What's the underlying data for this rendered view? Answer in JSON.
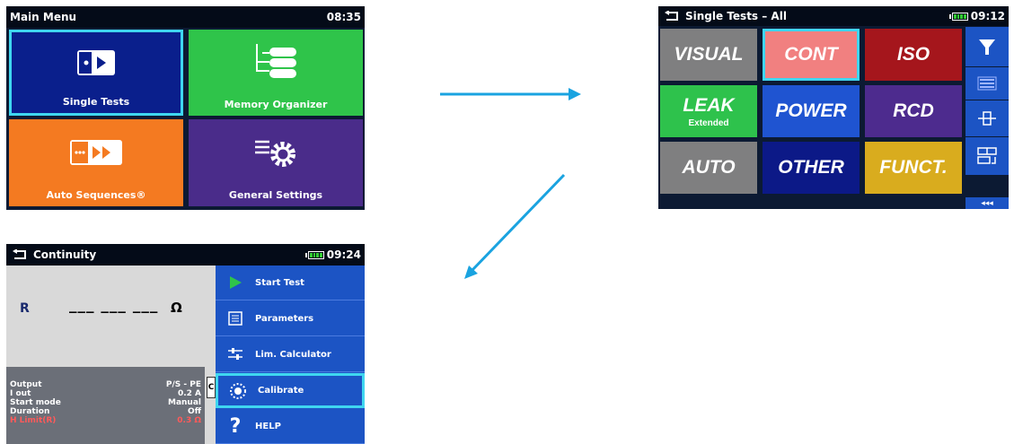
{
  "main_menu": {
    "title": "Main Menu",
    "time": "08:35",
    "tiles": [
      {
        "label": "Single Tests",
        "color": "#0a1f8c",
        "selected": true,
        "icon": "single-test-icon"
      },
      {
        "label": "Memory Organizer",
        "color": "#2fc44a",
        "icon": "memory-tree-icon"
      },
      {
        "label": "Auto Sequences®",
        "color": "#f47a21",
        "icon": "auto-sequence-icon"
      },
      {
        "label": "General Settings",
        "color": "#4a2c8a",
        "icon": "settings-gear-icon"
      }
    ]
  },
  "single_tests": {
    "title": "Single Tests – All",
    "time": "09:12",
    "tiles": [
      {
        "label": "VISUAL",
        "color": "#7f7f80"
      },
      {
        "label": "CONT",
        "color": "#f18080",
        "selected": true
      },
      {
        "label": "ISO",
        "color": "#a5161c"
      },
      {
        "label": "LEAK",
        "sub": "Extended",
        "color": "#2ec24c"
      },
      {
        "label": "POWER",
        "color": "#1f54d1"
      },
      {
        "label": "RCD",
        "color": "#4d2b8e"
      },
      {
        "label": "AUTO",
        "color": "#7f7f80"
      },
      {
        "label": "OTHER",
        "color": "#0c1987"
      },
      {
        "label": "FUNCT.",
        "color": "#d9ac1e"
      }
    ],
    "sidebar": [
      "filter-icon",
      "keyboard-icon",
      "expand-icon",
      "group-icon"
    ],
    "more_label": "◂◂◂"
  },
  "continuity": {
    "title": "Continuity",
    "time": "09:24",
    "result_label": "R",
    "result_value": "___ ___ ___",
    "result_unit": "Ω",
    "side_tab": "C",
    "params": [
      {
        "name": "Output",
        "value": "P/S - PE"
      },
      {
        "name": "I out",
        "value": "0.2 A"
      },
      {
        "name": "Start mode",
        "value": "Manual"
      },
      {
        "name": "Duration",
        "value": "Off"
      },
      {
        "name": "H Limit(R)",
        "value": "0.3 Ω",
        "alert": true
      }
    ],
    "menu": [
      {
        "label": "Start Test",
        "icon": "play-icon"
      },
      {
        "label": "Parameters",
        "icon": "list-icon"
      },
      {
        "label": "Lim. Calculator",
        "icon": "sliders-icon"
      },
      {
        "label": "Calibrate",
        "icon": "calibrate-icon",
        "selected": true
      },
      {
        "label": "HELP",
        "icon": "help-icon"
      }
    ]
  },
  "colors": {
    "arrow": "#1aa3e0",
    "selection": "#3fd6f0"
  }
}
